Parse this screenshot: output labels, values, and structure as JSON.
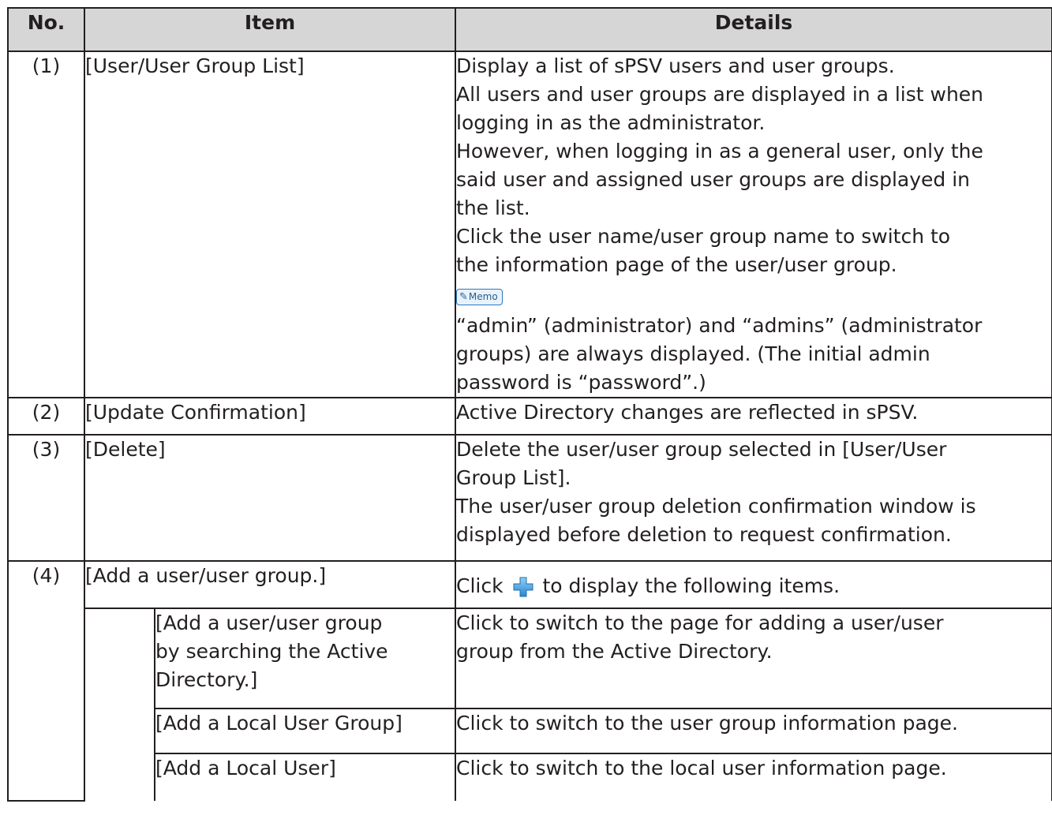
{
  "header": {
    "no": "No.",
    "item": "Item",
    "details": "Details"
  },
  "rows": [
    {
      "no": "(1)",
      "item": "[User/User Group List]",
      "details": [
        "Display a list of sPSV users and user groups.",
        "All users and user groups are displayed in a list when",
        "logging in as the administrator.",
        "However, when logging in as a general user, only the",
        "said user and assigned user groups are displayed in",
        "the list.",
        "Click the user name/user group name to switch to",
        "the information page of the user/user group."
      ],
      "memo_label": "Memo",
      "memo": [
        "“admin” (administrator) and “admins” (administrator",
        "groups) are always displayed. (The initial admin",
        "password is “password”.)"
      ]
    },
    {
      "no": "(2)",
      "item": "[Update Confirmation]",
      "details": [
        "Active Directory changes are reflected in sPSV."
      ]
    },
    {
      "no": "(3)",
      "item": "[Delete]",
      "details": [
        "Delete the user/user group selected in [User/User",
        "Group List].",
        "The user/user group deletion confirmation window is",
        "displayed before deletion to request confirmation."
      ]
    },
    {
      "no": "(4)",
      "item": "[Add a user/user group.]",
      "details_before": "Click",
      "details_icon": "plus-icon",
      "details_after": "to display the following items.",
      "subitems": [
        {
          "item": [
            "[Add a user/user group",
            "by searching the Active",
            "Directory.]"
          ],
          "details": [
            "Click to switch to the page for adding a user/user",
            "group from the Active Directory."
          ]
        },
        {
          "item": [
            "[Add a Local User Group]"
          ],
          "details": [
            "Click to switch to the user group information page."
          ]
        },
        {
          "item": [
            "[Add a Local User]"
          ],
          "details": [
            "Click to switch to the local user information page."
          ]
        }
      ]
    }
  ],
  "colors": {
    "header_bg": "#d6d6d6",
    "border": "#231f20",
    "memo_accent": "#2a7bbf",
    "plus_icon": "#3a9ad9"
  }
}
